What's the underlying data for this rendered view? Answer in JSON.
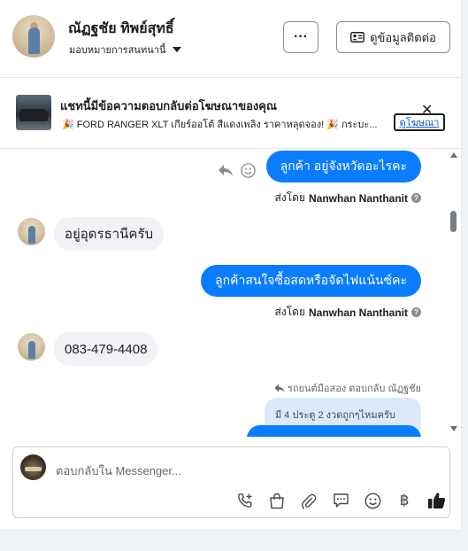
{
  "header": {
    "name": "ณัฏฐชัย ทิพย์สุทธิ์",
    "assign_label": "มอบหมายการสนทนานี้",
    "more_label": "···",
    "contact_button": "ดูข้อมูลติดต่อ"
  },
  "ad": {
    "title": "แชทนี้มีข้อความตอบกลับต่อโฆษณาของคุณ",
    "description": "🎉 FORD RANGER XLT เกียร์ออโต้ สีแดงเพลิง ราคาหลุดจอง! 🎉 กระบะ...",
    "link_label": "ดูโฆษณา",
    "close_label": "✕"
  },
  "messages": [
    {
      "direction": "out",
      "text": "ลูกค้า อยู่จังหวัดอะไรคะ",
      "sent_by_prefix": "ส่งโดย",
      "sent_by_name": "Nanwhan Nanthanit"
    },
    {
      "direction": "in",
      "text": "อยู่อุดรธานีครับ"
    },
    {
      "direction": "out",
      "text": "ลูกค้าสนใจซื้อสดหรือจัดไฟแน้นซ์คะ",
      "sent_by_prefix": "ส่งโดย",
      "sent_by_name": "Nanwhan Nanthanit"
    },
    {
      "direction": "in",
      "text": "083-479-4408"
    }
  ],
  "reply": {
    "note": "รถยนต์มือสอง ตอบกลับ ณัฏฐชัย",
    "quote": "มี 4 ประตู 2 งวดถูกๆไหมครับ"
  },
  "composer": {
    "placeholder": "ตอบกลับใน Messenger...",
    "tools": [
      "phone-plus-icon",
      "bag-icon",
      "paperclip-icon",
      "chat-bubble-icon",
      "emoji-icon",
      "baht-icon",
      "thumbs-up-icon"
    ],
    "baht_symbol": "฿"
  },
  "colors": {
    "accent": "#0a7cff",
    "incoming_bubble": "#f0f2f5",
    "quote_bubble": "#dce9fb"
  }
}
